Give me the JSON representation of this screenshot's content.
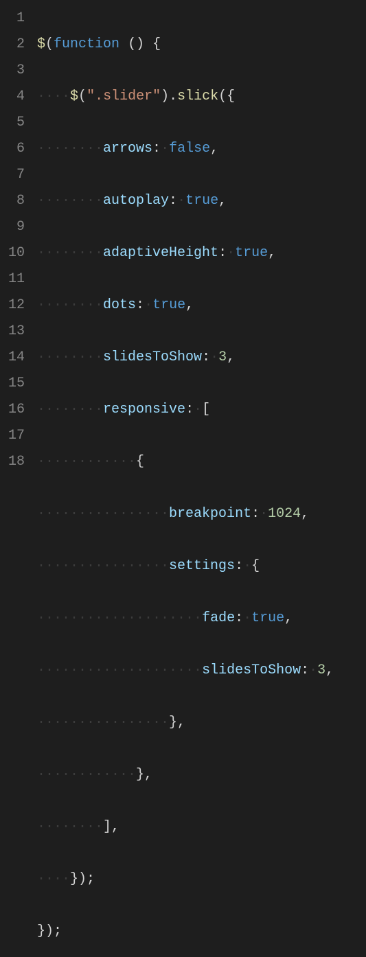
{
  "lineNumbers": [
    "1",
    "2",
    "3",
    "4",
    "5",
    "6",
    "7",
    "8",
    "9",
    "10",
    "11",
    "12",
    "13",
    "14",
    "15",
    "16",
    "17",
    "18"
  ],
  "code": {
    "l1": {
      "fn": "$",
      "p1": "(",
      "kw": "function",
      "sp": " ",
      "p2": "()",
      "sp2": " ",
      "p3": "{"
    },
    "l2": {
      "fn": "$",
      "p1": "(",
      "str": "\".slider\"",
      "p2": ").",
      "call": "slick",
      "p3": "({"
    },
    "l3": {
      "prop": "arrows",
      "p1": ":",
      "sp": " ",
      "val": "false",
      "p2": ","
    },
    "l4": {
      "prop": "autoplay",
      "p1": ":",
      "sp": " ",
      "val": "true",
      "p2": ","
    },
    "l5": {
      "prop": "adaptiveHeight",
      "p1": ":",
      "sp": " ",
      "val": "true",
      "p2": ","
    },
    "l6": {
      "prop": "dots",
      "p1": ":",
      "sp": " ",
      "val": "true",
      "p2": ","
    },
    "l7": {
      "prop": "slidesToShow",
      "p1": ":",
      "sp": " ",
      "val": "3",
      "p2": ","
    },
    "l8": {
      "prop": "responsive",
      "p1": ":",
      "sp": " ",
      "p2": "["
    },
    "l9": {
      "p1": "{"
    },
    "l10": {
      "prop": "breakpoint",
      "p1": ":",
      "sp": " ",
      "val": "1024",
      "p2": ","
    },
    "l11": {
      "prop": "settings",
      "p1": ":",
      "sp": " ",
      "p2": "{"
    },
    "l12": {
      "prop": "fade",
      "p1": ":",
      "sp": " ",
      "val": "true",
      "p2": ","
    },
    "l13": {
      "prop": "slidesToShow",
      "p1": ":",
      "sp": " ",
      "val": "3",
      "p2": ","
    },
    "l14": {
      "p1": "},"
    },
    "l15": {
      "p1": "},"
    },
    "l16": {
      "p1": "],"
    },
    "l17": {
      "p1": "});"
    },
    "l18": {
      "p1": "});"
    }
  },
  "indent": {
    "dot": "·",
    "i1": "····",
    "i2": "········",
    "i3": "············",
    "i4": "················",
    "i5": "····················"
  }
}
